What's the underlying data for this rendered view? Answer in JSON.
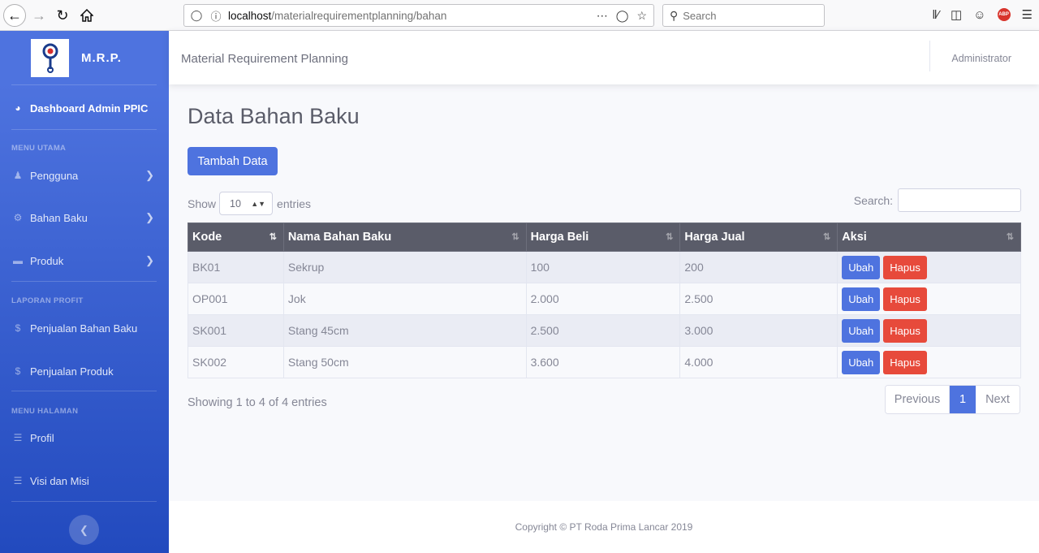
{
  "browser": {
    "url_host": "localhost",
    "url_path": "/materialrequirementplanning/bahan",
    "search_placeholder": "Search"
  },
  "sidebar": {
    "brand": "M.R.P.",
    "dashboard": "Dashboard Admin PPIC",
    "headings": [
      "MENU UTAMA",
      "LAPORAN PROFIT",
      "MENU HALAMAN"
    ],
    "menu_utama": [
      {
        "label": "Pengguna",
        "icon": "users-icon"
      },
      {
        "label": "Bahan Baku",
        "icon": "cog-icon"
      },
      {
        "label": "Produk",
        "icon": "box-icon"
      }
    ],
    "laporan": [
      {
        "label": "Penjualan Bahan Baku",
        "icon": "dollar-icon"
      },
      {
        "label": "Penjualan Produk",
        "icon": "dollar-icon"
      }
    ],
    "halaman": [
      {
        "label": "Profil",
        "icon": "list-icon"
      },
      {
        "label": "Visi dan Misi",
        "icon": "list-icon"
      }
    ]
  },
  "topbar": {
    "title": "Material Requirement Planning",
    "user": "Administrator"
  },
  "main": {
    "page_title": "Data Bahan Baku",
    "add_button": "Tambah Data",
    "show_label": "Show",
    "entries_value": "10",
    "entries_label": "entries",
    "search_label": "Search:",
    "columns": [
      "Kode",
      "Nama Bahan Baku",
      "Harga Beli",
      "Harga Jual",
      "Aksi"
    ],
    "rows": [
      {
        "kode": "BK01",
        "nama": "Sekrup",
        "beli": "100",
        "jual": "200"
      },
      {
        "kode": "OP001",
        "nama": "Jok",
        "beli": "2.000",
        "jual": "2.500"
      },
      {
        "kode": "SK001",
        "nama": "Stang 45cm",
        "beli": "2.500",
        "jual": "3.000"
      },
      {
        "kode": "SK002",
        "nama": "Stang 50cm",
        "beli": "3.600",
        "jual": "4.000"
      }
    ],
    "edit_label": "Ubah",
    "delete_label": "Hapus",
    "info": "Showing 1 to 4 of 4 entries",
    "pager": {
      "previous": "Previous",
      "page": "1",
      "next": "Next"
    }
  },
  "footer": {
    "copyright": "Copyright © PT Roda Prima Lancar 2019"
  }
}
